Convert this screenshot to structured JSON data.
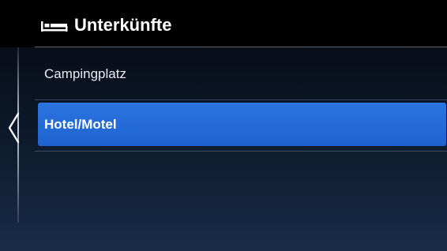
{
  "header": {
    "title": "Unterkünfte",
    "icon": "bed-icon"
  },
  "list": {
    "items": [
      {
        "label": "Campingplatz",
        "selected": false
      },
      {
        "label": "Hotel/Motel",
        "selected": true
      }
    ]
  },
  "navigation": {
    "back_icon": "chevron-left-icon"
  },
  "colors": {
    "selected_background": "#2368d6",
    "header_background": "#000000",
    "text": "#ffffff"
  }
}
